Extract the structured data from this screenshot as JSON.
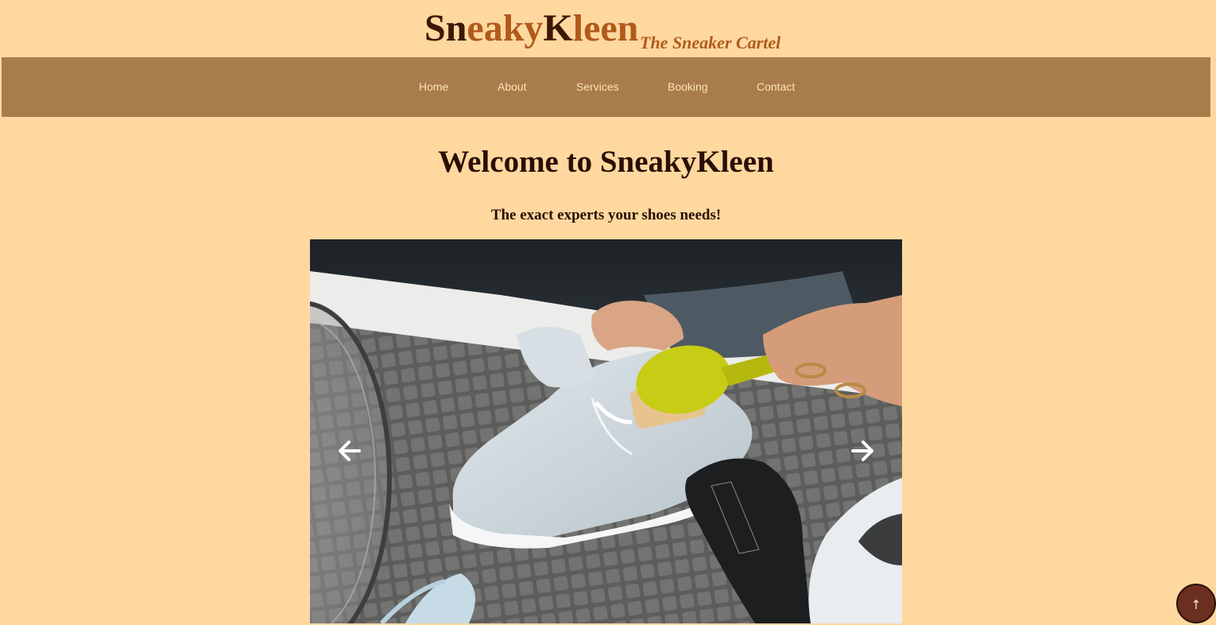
{
  "brand": {
    "name_parts": [
      "Sn",
      "eaky",
      "K",
      "leen"
    ],
    "tagline": "The Sneaker Cartel",
    "colors": {
      "dark": "#3d1806",
      "light": "#b15a1c"
    }
  },
  "nav": {
    "items": [
      {
        "label": "Home"
      },
      {
        "label": "About"
      },
      {
        "label": "Services"
      },
      {
        "label": "Booking"
      },
      {
        "label": "Contact"
      }
    ]
  },
  "hero": {
    "title": "Welcome to SneakyKleen",
    "subtitle": "The exact experts your shoes needs!"
  },
  "carousel": {
    "prev_icon": "arrow-left-icon",
    "next_icon": "arrow-right-icon"
  },
  "scroll_top": {
    "icon": "up-arrow-icon",
    "label": "↑"
  },
  "colors": {
    "background": "#ffd89f",
    "navbar": "#a97c4b",
    "nav_text": "#fde2b6",
    "heading": "#2b0f05",
    "scroll_button": "#6b2f1f"
  }
}
